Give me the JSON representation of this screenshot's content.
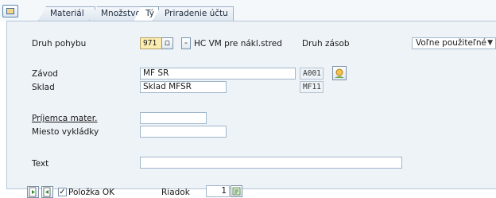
{
  "tabs": [
    {
      "label": "Materiál"
    },
    {
      "label": "Množstvo"
    },
    {
      "label": "Tý"
    },
    {
      "label": "Priradenie účtu"
    }
  ],
  "active_tab_index": 2,
  "form": {
    "movement_type_label": "Druh pohybu",
    "movement_type_value": "971",
    "movement_type_sign": "-",
    "movement_type_desc": "HC VM pre nákl.stred",
    "stock_type_label": "Druh zásob",
    "stock_type_value": "Voľne použiteľné",
    "plant_label": "Závod",
    "plant_value": "MF SR",
    "plant_code": "A001",
    "storage_label": "Sklad",
    "storage_value": "Sklad MFSR",
    "storage_code": "MF11",
    "recipient_label": "Príjemca mater.",
    "recipient_value": "",
    "unloading_label": "Miesto vykládky",
    "unloading_value": "",
    "text_label": "Text",
    "text_value": ""
  },
  "footer": {
    "item_ok_label": "Položka OK",
    "item_ok_checked": true,
    "row_label": "Riadok",
    "row_value": "1"
  },
  "icons": {
    "menu": "menu-icon",
    "value_help": "value-help-icon",
    "plant_map": "map-icon",
    "prev": "prev-item-icon",
    "next": "next-item-icon",
    "row_help": "row-nav-icon"
  },
  "colors": {
    "panel_bg": "#eef3f8",
    "required_field": "#fbedb0",
    "tab_border": "#9ab2c8"
  }
}
